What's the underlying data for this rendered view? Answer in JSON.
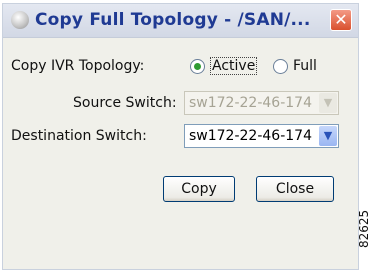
{
  "window": {
    "title": "Copy Full Topology - /SAN/...",
    "close_symbol": "✕",
    "app_icon": "globe-icon"
  },
  "form": {
    "copy_ivr_label": "Copy IVR Topology:",
    "options": [
      {
        "label": "Active",
        "selected": true
      },
      {
        "label": "Full",
        "selected": false
      }
    ],
    "source_label": "Source Switch:",
    "source_value": "sw172-22-46-174",
    "source_enabled": false,
    "destination_label": "Destination Switch:",
    "destination_value": "sw172-22-46-174",
    "destination_enabled": true
  },
  "buttons": {
    "copy": "Copy",
    "close": "Close"
  },
  "figure_id": "82625",
  "colors": {
    "title_text": "#1f3a93",
    "close_button": "#d9502e",
    "radio_selected": "#2f9b32",
    "combo_border": "#7f9db9",
    "dialog_bg": "#f0f0ea"
  }
}
